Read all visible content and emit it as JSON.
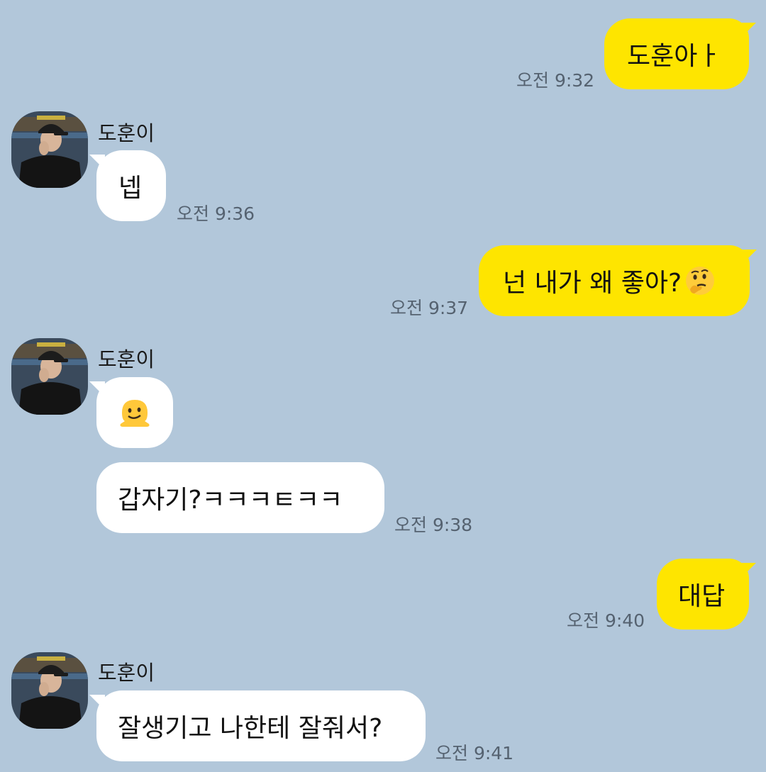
{
  "contact": {
    "name": "도훈이"
  },
  "colors": {
    "background": "#b2c7da",
    "my_bubble": "#fee500",
    "their_bubble": "#ffffff",
    "timestamp": "#556270"
  },
  "messages": [
    {
      "sender": "me",
      "text": "도훈아ㅏ",
      "time": "오전 9:32"
    },
    {
      "sender": "them",
      "show_name": true,
      "text": "넵",
      "time": "오전 9:36"
    },
    {
      "sender": "me",
      "text": "넌 내가 왜 좋아?",
      "emoji": "thinking-face",
      "time": "오전 9:37"
    },
    {
      "sender": "them",
      "show_name": true,
      "emoji": "melting-face",
      "text": "",
      "time": ""
    },
    {
      "sender": "them",
      "show_name": false,
      "text": "갑자기?ㅋㅋㅋㅌㅋㅋ",
      "time": "오전 9:38"
    },
    {
      "sender": "me",
      "text": "대답",
      "time": "오전 9:40"
    },
    {
      "sender": "them",
      "show_name": true,
      "text": "잘생기고 나한테 잘줘서?",
      "time": "오전 9:41"
    }
  ]
}
